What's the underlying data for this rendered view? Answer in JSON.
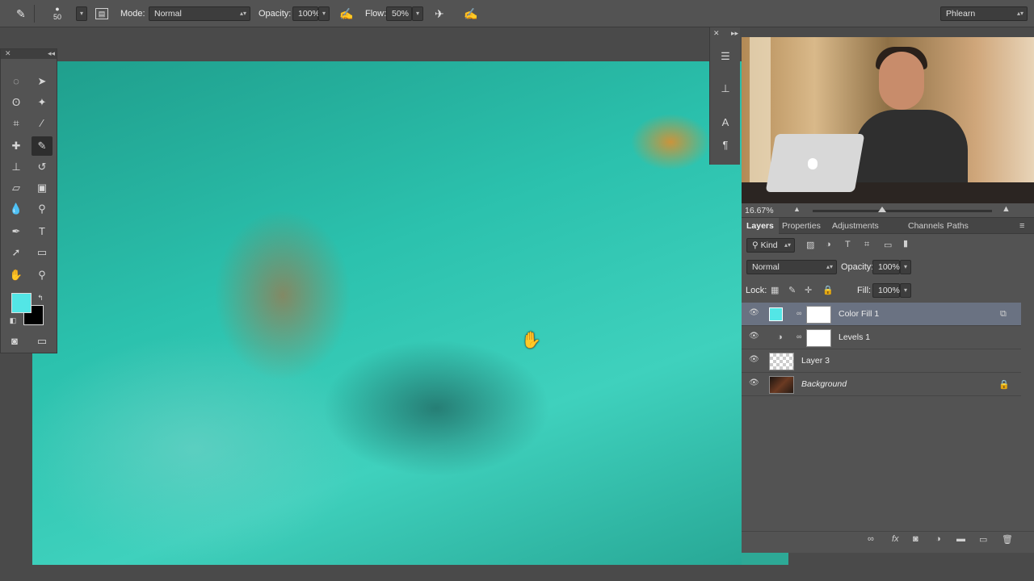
{
  "options_bar": {
    "brush_size": "50",
    "mode_label": "Mode:",
    "mode_value": "Normal",
    "opacity_label": "Opacity:",
    "opacity_value": "100%",
    "flow_label": "Flow:",
    "flow_value": "50%",
    "workspace": "Phlearn"
  },
  "tools": {
    "foreground_color": "#53e6e6",
    "background_color": "#000000",
    "selected": "brush-tool"
  },
  "navigator": {
    "zoom": "16.67%"
  },
  "layers_panel": {
    "tabs": [
      "Layers",
      "Properties",
      "Adjustments",
      "Channels",
      "Paths"
    ],
    "active_tab": "Layers",
    "filter_label": "Kind",
    "blend_mode": "Normal",
    "opacity_label": "Opacity:",
    "opacity_value": "100%",
    "lock_label": "Lock:",
    "fill_label": "Fill:",
    "fill_value": "100%",
    "layers": [
      {
        "name": "Color Fill 1",
        "selected": true
      },
      {
        "name": "Levels 1",
        "selected": false
      },
      {
        "name": "Layer 3",
        "selected": false
      },
      {
        "name": "Background",
        "selected": false,
        "locked": true
      }
    ]
  },
  "canvas": {
    "cursor": "hand-cursor-icon",
    "tint_color": "#2bc1ad"
  }
}
